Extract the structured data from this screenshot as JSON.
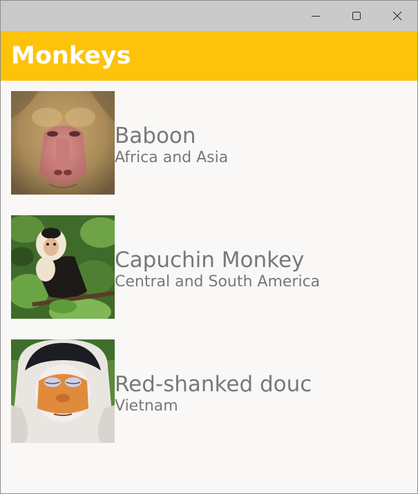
{
  "window": {
    "controls": [
      "minimize-icon",
      "maximize-icon",
      "close-icon"
    ]
  },
  "header": {
    "title": "Monkeys",
    "color": "#FDC30A"
  },
  "monkeys": [
    {
      "name": "Baboon",
      "location": "Africa and Asia",
      "image": "baboon-photo"
    },
    {
      "name": "Capuchin Monkey",
      "location": "Central and South America",
      "image": "capuchin-monkey-photo"
    },
    {
      "name": "Red-shanked douc",
      "location": "Vietnam",
      "image": "red-shanked-douc-photo"
    }
  ]
}
